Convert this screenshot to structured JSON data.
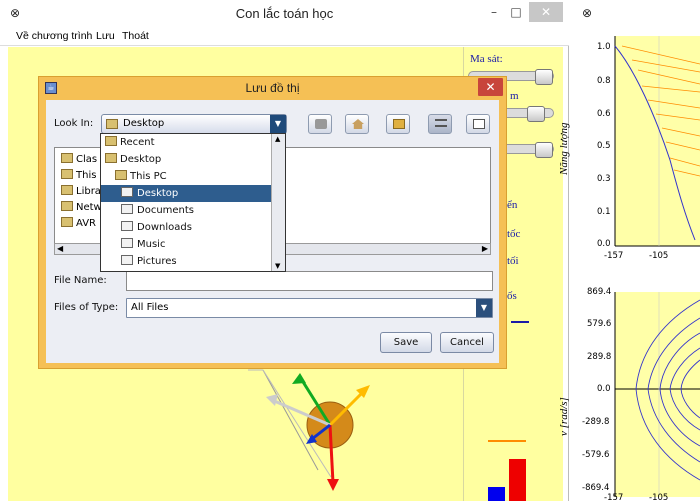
{
  "main_window": {
    "title": "Con lắc toán học",
    "menu": [
      "Về chương trình",
      "Lưu",
      "Thoát"
    ]
  },
  "controls": {
    "friction_label": "Ma sát:",
    "label_2_fragment": "m",
    "label_3_fragment": "ển",
    "label_4_fragment": "tốc",
    "label_5_fragment": "tối",
    "label_6_fragment": "ốs"
  },
  "energy_plot": {
    "ylabel": "Năng lượng",
    "yticks": [
      "1.0",
      "0.8",
      "0.6",
      "0.5",
      "0.3",
      "0.1",
      "0.0"
    ],
    "xticks": [
      "-157",
      "-105"
    ]
  },
  "phase_plot": {
    "ylabel": "v [rad/s]",
    "yticks": [
      "869.4",
      "579.6",
      "289.8",
      "0.0",
      "-289.8",
      "-579.6",
      "-869.4"
    ],
    "xticks": [
      "-157",
      "-105"
    ]
  },
  "dialog": {
    "title": "Lưu đồ thị",
    "look_in_label": "Look In:",
    "look_in_value": "Desktop",
    "file_name_label": "File Name:",
    "file_name_value": "",
    "files_of_type_label": "Files of Type:",
    "files_of_type_value": "All Files",
    "save_label": "Save",
    "cancel_label": "Cancel",
    "file_list": [
      "Clas",
      "This",
      "Libra",
      "Netw",
      "AVR"
    ],
    "look_in_options": [
      "Recent",
      "Desktop",
      "This PC",
      "Desktop",
      "Documents",
      "Downloads",
      "Music",
      "Pictures"
    ],
    "selected_option_index": 3
  },
  "colors": {
    "plot_bg": "#ffffa8",
    "dialog_frame": "#f5c055",
    "selection": "#2e5d8e",
    "energy_lines": "#ff8c00",
    "curve_blue": "#3333cc",
    "arrow_green": "#11aa22",
    "arrow_yellow": "#ffbb00",
    "arrow_red": "#ee1111",
    "arrow_blue": "#1133cc",
    "bob": "#d48a1a"
  }
}
